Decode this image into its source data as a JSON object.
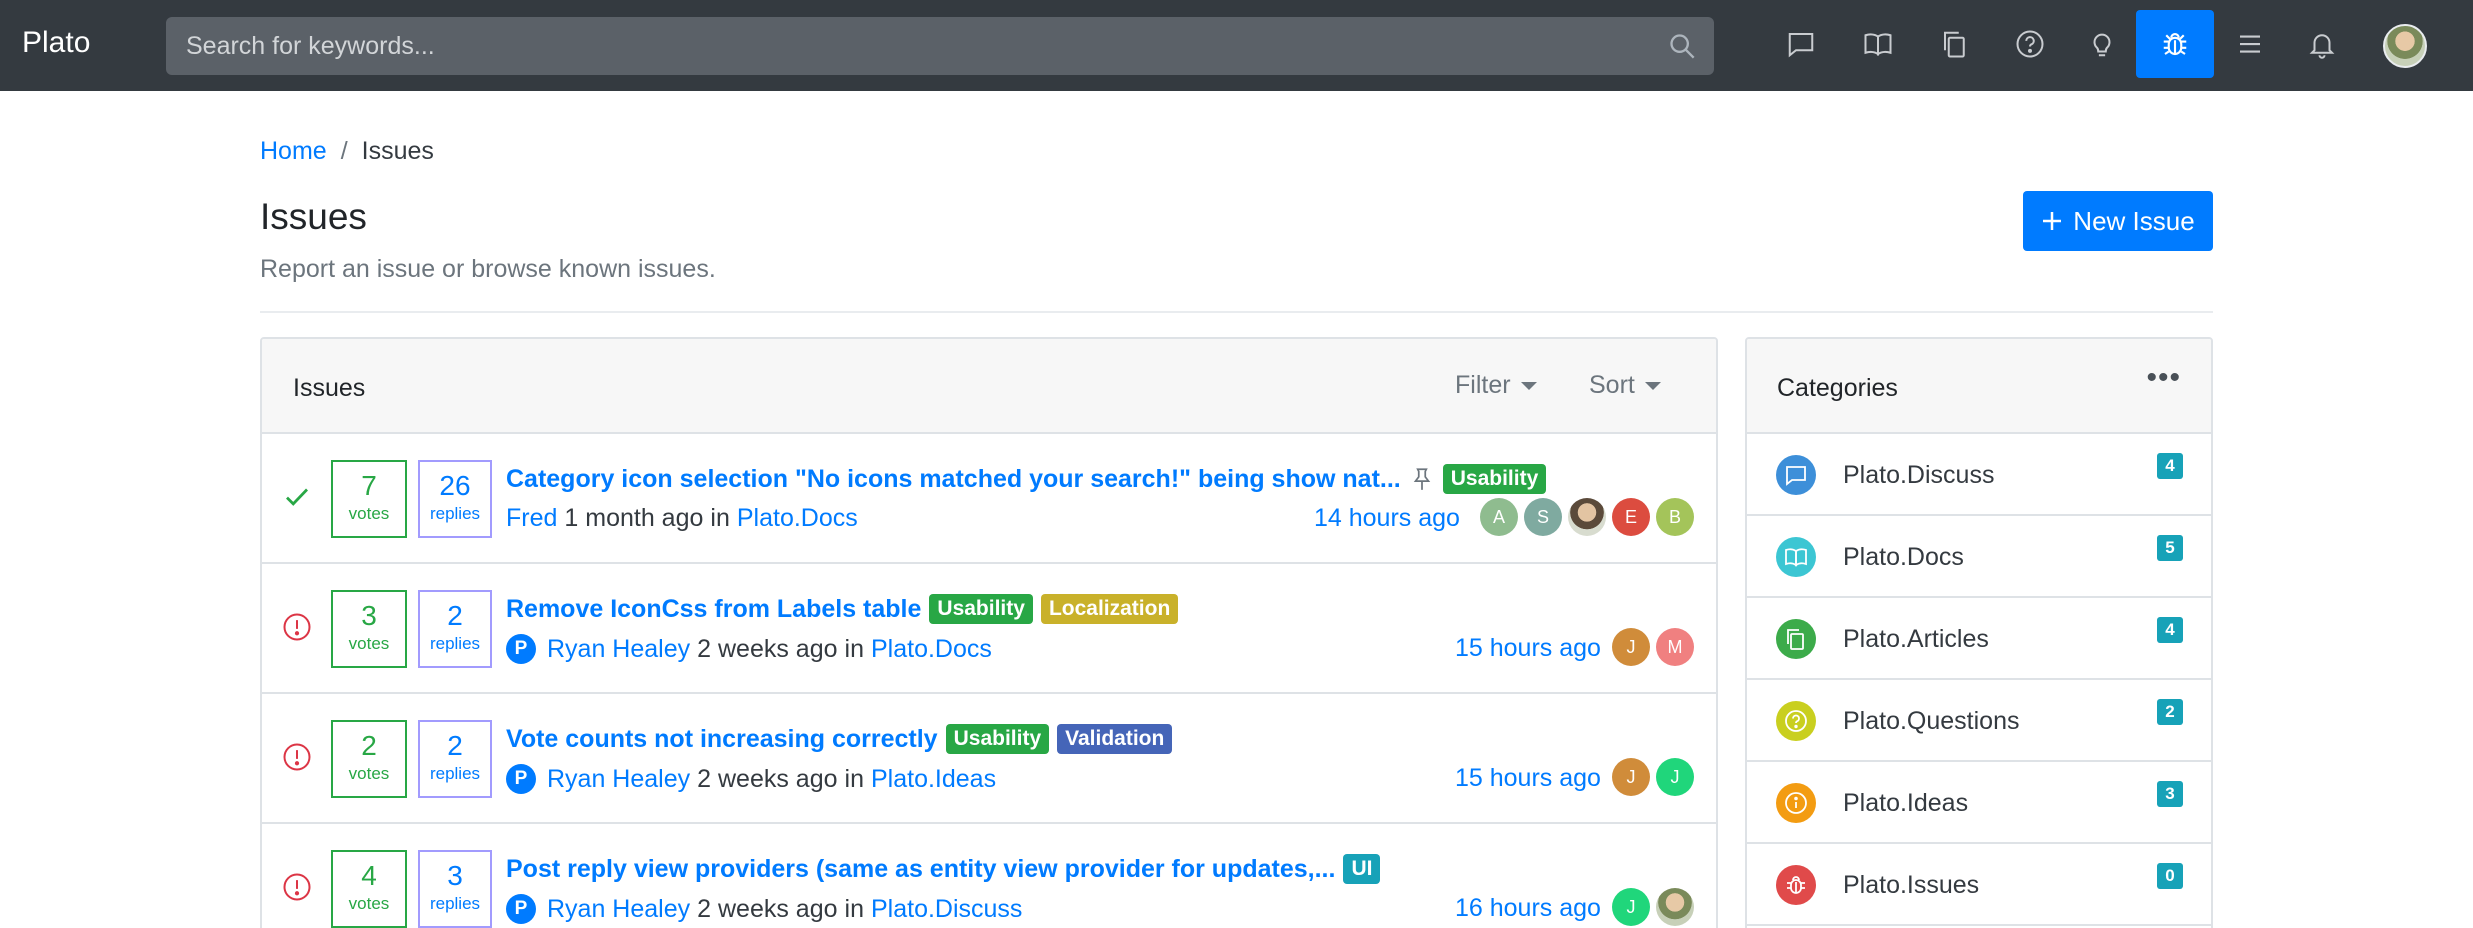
{
  "nav": {
    "brand": "Plato",
    "search_placeholder": "Search for keywords..."
  },
  "header": {
    "breadcrumb_home": "Home",
    "breadcrumb_sep": "/",
    "breadcrumb_current": "Issues",
    "title": "Issues",
    "subtitle": "Report an issue or browse known issues.",
    "new_issue_label": "New Issue"
  },
  "issues_card": {
    "title": "Issues",
    "filter_label": "Filter",
    "sort_label": "Sort",
    "rows": [
      {
        "votes": "7",
        "votes_label": "votes",
        "replies": "26",
        "replies_label": "replies",
        "title": "Category icon selection \"No icons matched your search!\" being show nat...",
        "labels": [
          {
            "text": "Usability",
            "color": "#28a745"
          }
        ],
        "author": "Fred",
        "ago": "1 month ago",
        "in": "in",
        "category": "Plato.Docs",
        "updated": "14 hours ago",
        "avatars": [
          {
            "letter": "A",
            "color": "#8fbc8f"
          },
          {
            "letter": "S",
            "color": "#7faaa0"
          },
          {
            "letter": "",
            "color": "photo"
          },
          {
            "letter": "E",
            "color": "#dc4c3f"
          },
          {
            "letter": "B",
            "color": "#a4c45a"
          }
        ]
      },
      {
        "votes": "3",
        "votes_label": "votes",
        "replies": "2",
        "replies_label": "replies",
        "title": "Remove IconCss from Labels table",
        "labels": [
          {
            "text": "Usability",
            "color": "#28a745"
          },
          {
            "text": "Localization",
            "color": "#c9b12a"
          }
        ],
        "author_badge": "P",
        "author": "Ryan Healey",
        "ago": "2 weeks ago",
        "in": "in",
        "category": "Plato.Docs",
        "updated": "15 hours ago",
        "avatars": [
          {
            "letter": "J",
            "color": "#d08c3a"
          },
          {
            "letter": "M",
            "color": "#f08080"
          }
        ]
      },
      {
        "votes": "2",
        "votes_label": "votes",
        "replies": "2",
        "replies_label": "replies",
        "title": "Vote counts not increasing correctly",
        "labels": [
          {
            "text": "Usability",
            "color": "#28a745"
          },
          {
            "text": "Validation",
            "color": "#4565b8"
          }
        ],
        "author_badge": "P",
        "author": "Ryan Healey",
        "ago": "2 weeks ago",
        "in": "in",
        "category": "Plato.Ideas",
        "updated": "15 hours ago",
        "avatars": [
          {
            "letter": "J",
            "color": "#d08c3a"
          },
          {
            "letter": "J",
            "color": "#20d67b"
          }
        ]
      },
      {
        "votes": "4",
        "votes_label": "votes",
        "replies": "3",
        "replies_label": "replies",
        "title": "Post reply view providers (same as entity view provider for updates,...",
        "labels": [
          {
            "text": "UI",
            "color": "#17a2b8"
          }
        ],
        "author_badge": "P",
        "author": "Ryan Healey",
        "ago": "2 weeks ago",
        "in": "in",
        "category": "Plato.Discuss",
        "updated": "16 hours ago",
        "avatars": [
          {
            "letter": "J",
            "color": "#20d67b"
          },
          {
            "letter": "",
            "color": "photo2"
          }
        ]
      }
    ]
  },
  "categories": {
    "title": "Categories",
    "more": "•••",
    "items": [
      {
        "name": "Plato.Discuss",
        "count": "4",
        "color": "#3d8fd9",
        "icon": "chat-icon"
      },
      {
        "name": "Plato.Docs",
        "count": "5",
        "color": "#3cc6d3",
        "icon": "book-icon"
      },
      {
        "name": "Plato.Articles",
        "count": "4",
        "color": "#3cab4a",
        "icon": "copy-icon"
      },
      {
        "name": "Plato.Questions",
        "count": "2",
        "color": "#c9cf1f",
        "icon": "question-icon"
      },
      {
        "name": "Plato.Ideas",
        "count": "3",
        "color": "#f39c12",
        "icon": "info-icon"
      },
      {
        "name": "Plato.Issues",
        "count": "0",
        "color": "#e04a4a",
        "icon": "bug-icon"
      }
    ]
  }
}
